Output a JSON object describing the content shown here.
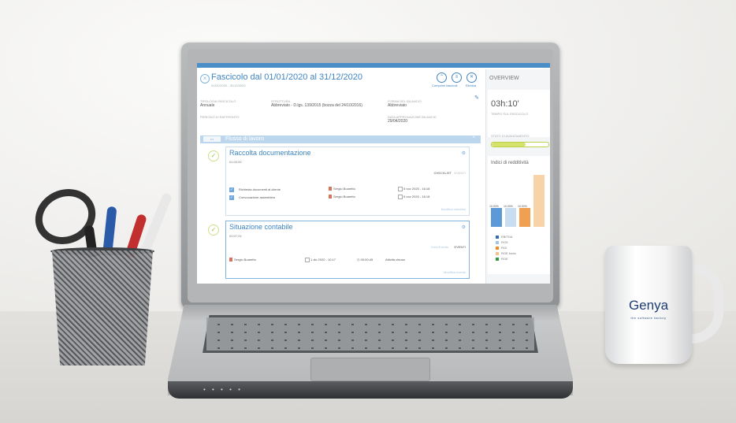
{
  "app": {
    "title": "Fascicolo dal 01/01/2020 al 31/12/2020",
    "subtitle": "01/01/2020 - 31/12/2020",
    "actions": [
      {
        "label": "Comprimi fascicoli",
        "icon": "chevron-up-icon"
      },
      {
        "label": "Elimina",
        "icon": "trash-icon"
      }
    ]
  },
  "fields": {
    "tipologia_label": "TIPOLOGIA FASCICOLO",
    "tipologia_value": "Annuale",
    "struttura_label": "STRUTTURA",
    "struttura_value": "Abbreviato - D.lgs. 139/2015 (bozza del 24/10/2016)",
    "forma_label": "FORMA DEL BILANCIO",
    "forma_value": "Abbreviato",
    "periodo_label": "PERIODO DI RAFFRONTO",
    "approvazione_label": "DATA APPROVAZIONE BILANCIO",
    "approvazione_value": "29/04/2020"
  },
  "flow": {
    "title": "Flusso di lavoro"
  },
  "cards": [
    {
      "title": "Raccolta documentazione",
      "time": "01:00:00",
      "tabs": [
        "CHECKLIST",
        "EVENTI"
      ],
      "rows": [
        {
          "task": "Richiesta documenti al cliente",
          "person": "Sergio Boaretto",
          "date": "5 nov 2020 - 16:18"
        },
        {
          "task": "Convocazione assemblea",
          "person": "Sergio Boaretto",
          "date": "5 nov 2020 - 16:18"
        }
      ],
      "footer": "Modifica checklist"
    },
    {
      "title": "Situazione contabile",
      "time": "02:07:24",
      "tabs": [
        "Crea Evento",
        "EVENTI"
      ],
      "rows": [
        {
          "person": "Sergio Boaretto",
          "date": "1 dic 2020 - 10:17",
          "duration": "00:00:45",
          "status": "Attività chiusa"
        }
      ],
      "footer": "Modifica evento"
    }
  ],
  "overview": {
    "title": "OVERVIEW",
    "time": "03h:10'",
    "time_label": "TEMPO SUL FASCICOLO",
    "progress_label": "STATO DI AVANZAMENTO",
    "progress_fraction": 0.6,
    "chart_title": "Indici di redditività",
    "bar_labels": [
      "10.00%",
      "10.00%",
      "10.00%"
    ],
    "legend": [
      {
        "label": "EBITDA",
        "color": "#2f6db5"
      },
      {
        "label": "ROS",
        "color": "#9fc5e8"
      },
      {
        "label": "ROI",
        "color": "#f08a24"
      },
      {
        "label": "ROE lordo",
        "color": "#f5c08a"
      },
      {
        "label": "ROE",
        "color": "#2e9a3e"
      }
    ]
  },
  "mug": {
    "brand": "Genya",
    "tagline": "the software factory"
  }
}
